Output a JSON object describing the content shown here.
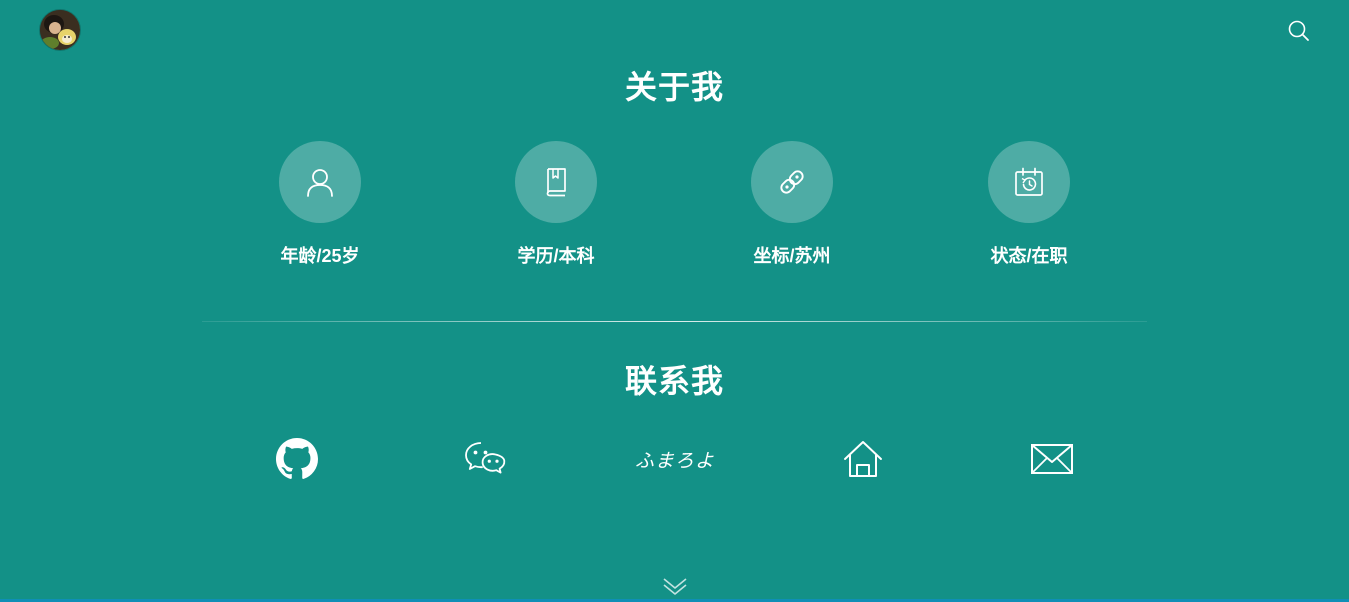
{
  "header": {
    "avatar_icon": "user-avatar",
    "search_icon": "search-icon"
  },
  "about": {
    "title": "关于我",
    "items": [
      {
        "icon": "user-icon",
        "label": "年龄/25岁"
      },
      {
        "icon": "book-icon",
        "label": "学历/本科"
      },
      {
        "icon": "link-icon",
        "label": "坐标/苏州"
      },
      {
        "icon": "calendar-history-icon",
        "label": "状态/在职"
      }
    ]
  },
  "contact": {
    "title": "联系我",
    "items": [
      {
        "icon": "github-icon"
      },
      {
        "icon": "wechat-icon"
      },
      {
        "icon": "script-logo-icon",
        "text": "ふまろよ"
      },
      {
        "icon": "home-icon"
      },
      {
        "icon": "mail-icon"
      }
    ]
  },
  "footer": {
    "scroll_icon": "double-chevron-down-icon"
  },
  "colors": {
    "background": "#139187",
    "circle": "rgba(255,255,255,0.25)",
    "text": "#ffffff",
    "bottom_line": "#0f8fb6"
  }
}
